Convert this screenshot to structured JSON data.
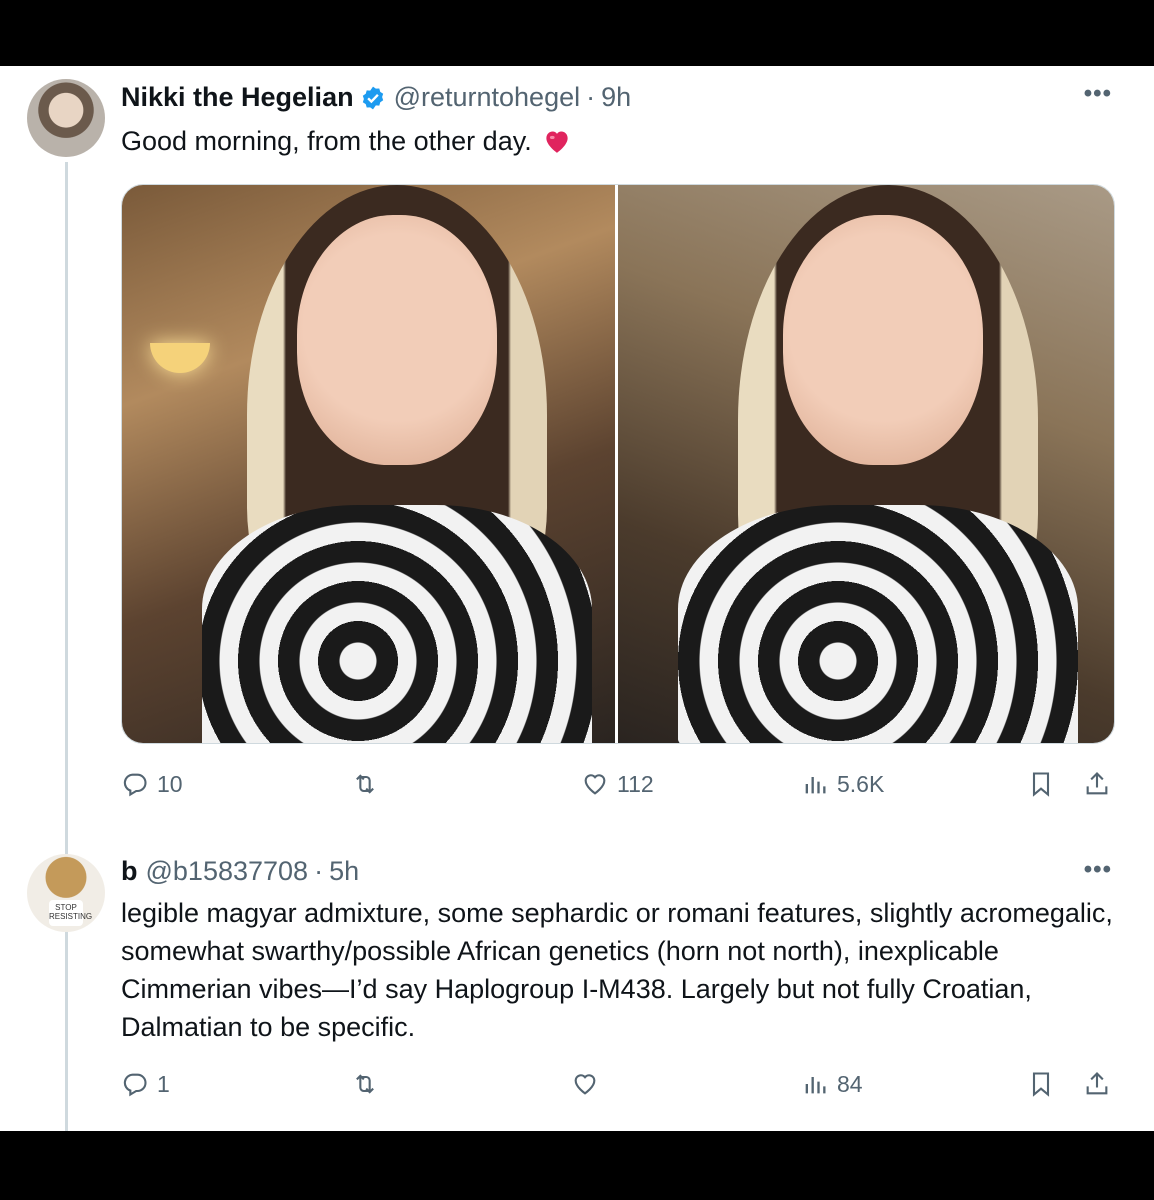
{
  "tweets": [
    {
      "display_name": "Nikki the Hegelian",
      "handle": "@returntohegel",
      "separator": "·",
      "time": "9h",
      "text": "Good morning, from the other day.",
      "verified": true,
      "counts": {
        "replies": "10",
        "reposts": "",
        "likes": "112",
        "views": "5.6K"
      }
    },
    {
      "display_name": "b",
      "handle": "@b15837708",
      "separator": "·",
      "time": "5h",
      "text": "legible magyar admixture, some sephardic or romani features, slightly acromegalic, somewhat swarthy/possible African genetics (horn not north), inexplicable Cimmerian vibes—I’d say Haplogroup I-M438. Largely but not fully Croatian, Dalmatian to be specific.",
      "avatar_text": "STOP RESISTING",
      "counts": {
        "replies": "1",
        "reposts": "",
        "likes": "",
        "views": "84"
      }
    }
  ],
  "colors": {
    "text": "#0f1419",
    "muted": "#536471",
    "verified": "#1d9bf0",
    "heart": "#e0245e",
    "divider": "#cfd9de"
  },
  "icons": [
    "reply-icon",
    "repost-icon",
    "like-icon",
    "views-icon",
    "bookmark-icon",
    "share-icon",
    "more-icon",
    "verified-badge-icon",
    "heart-emoji-icon"
  ]
}
